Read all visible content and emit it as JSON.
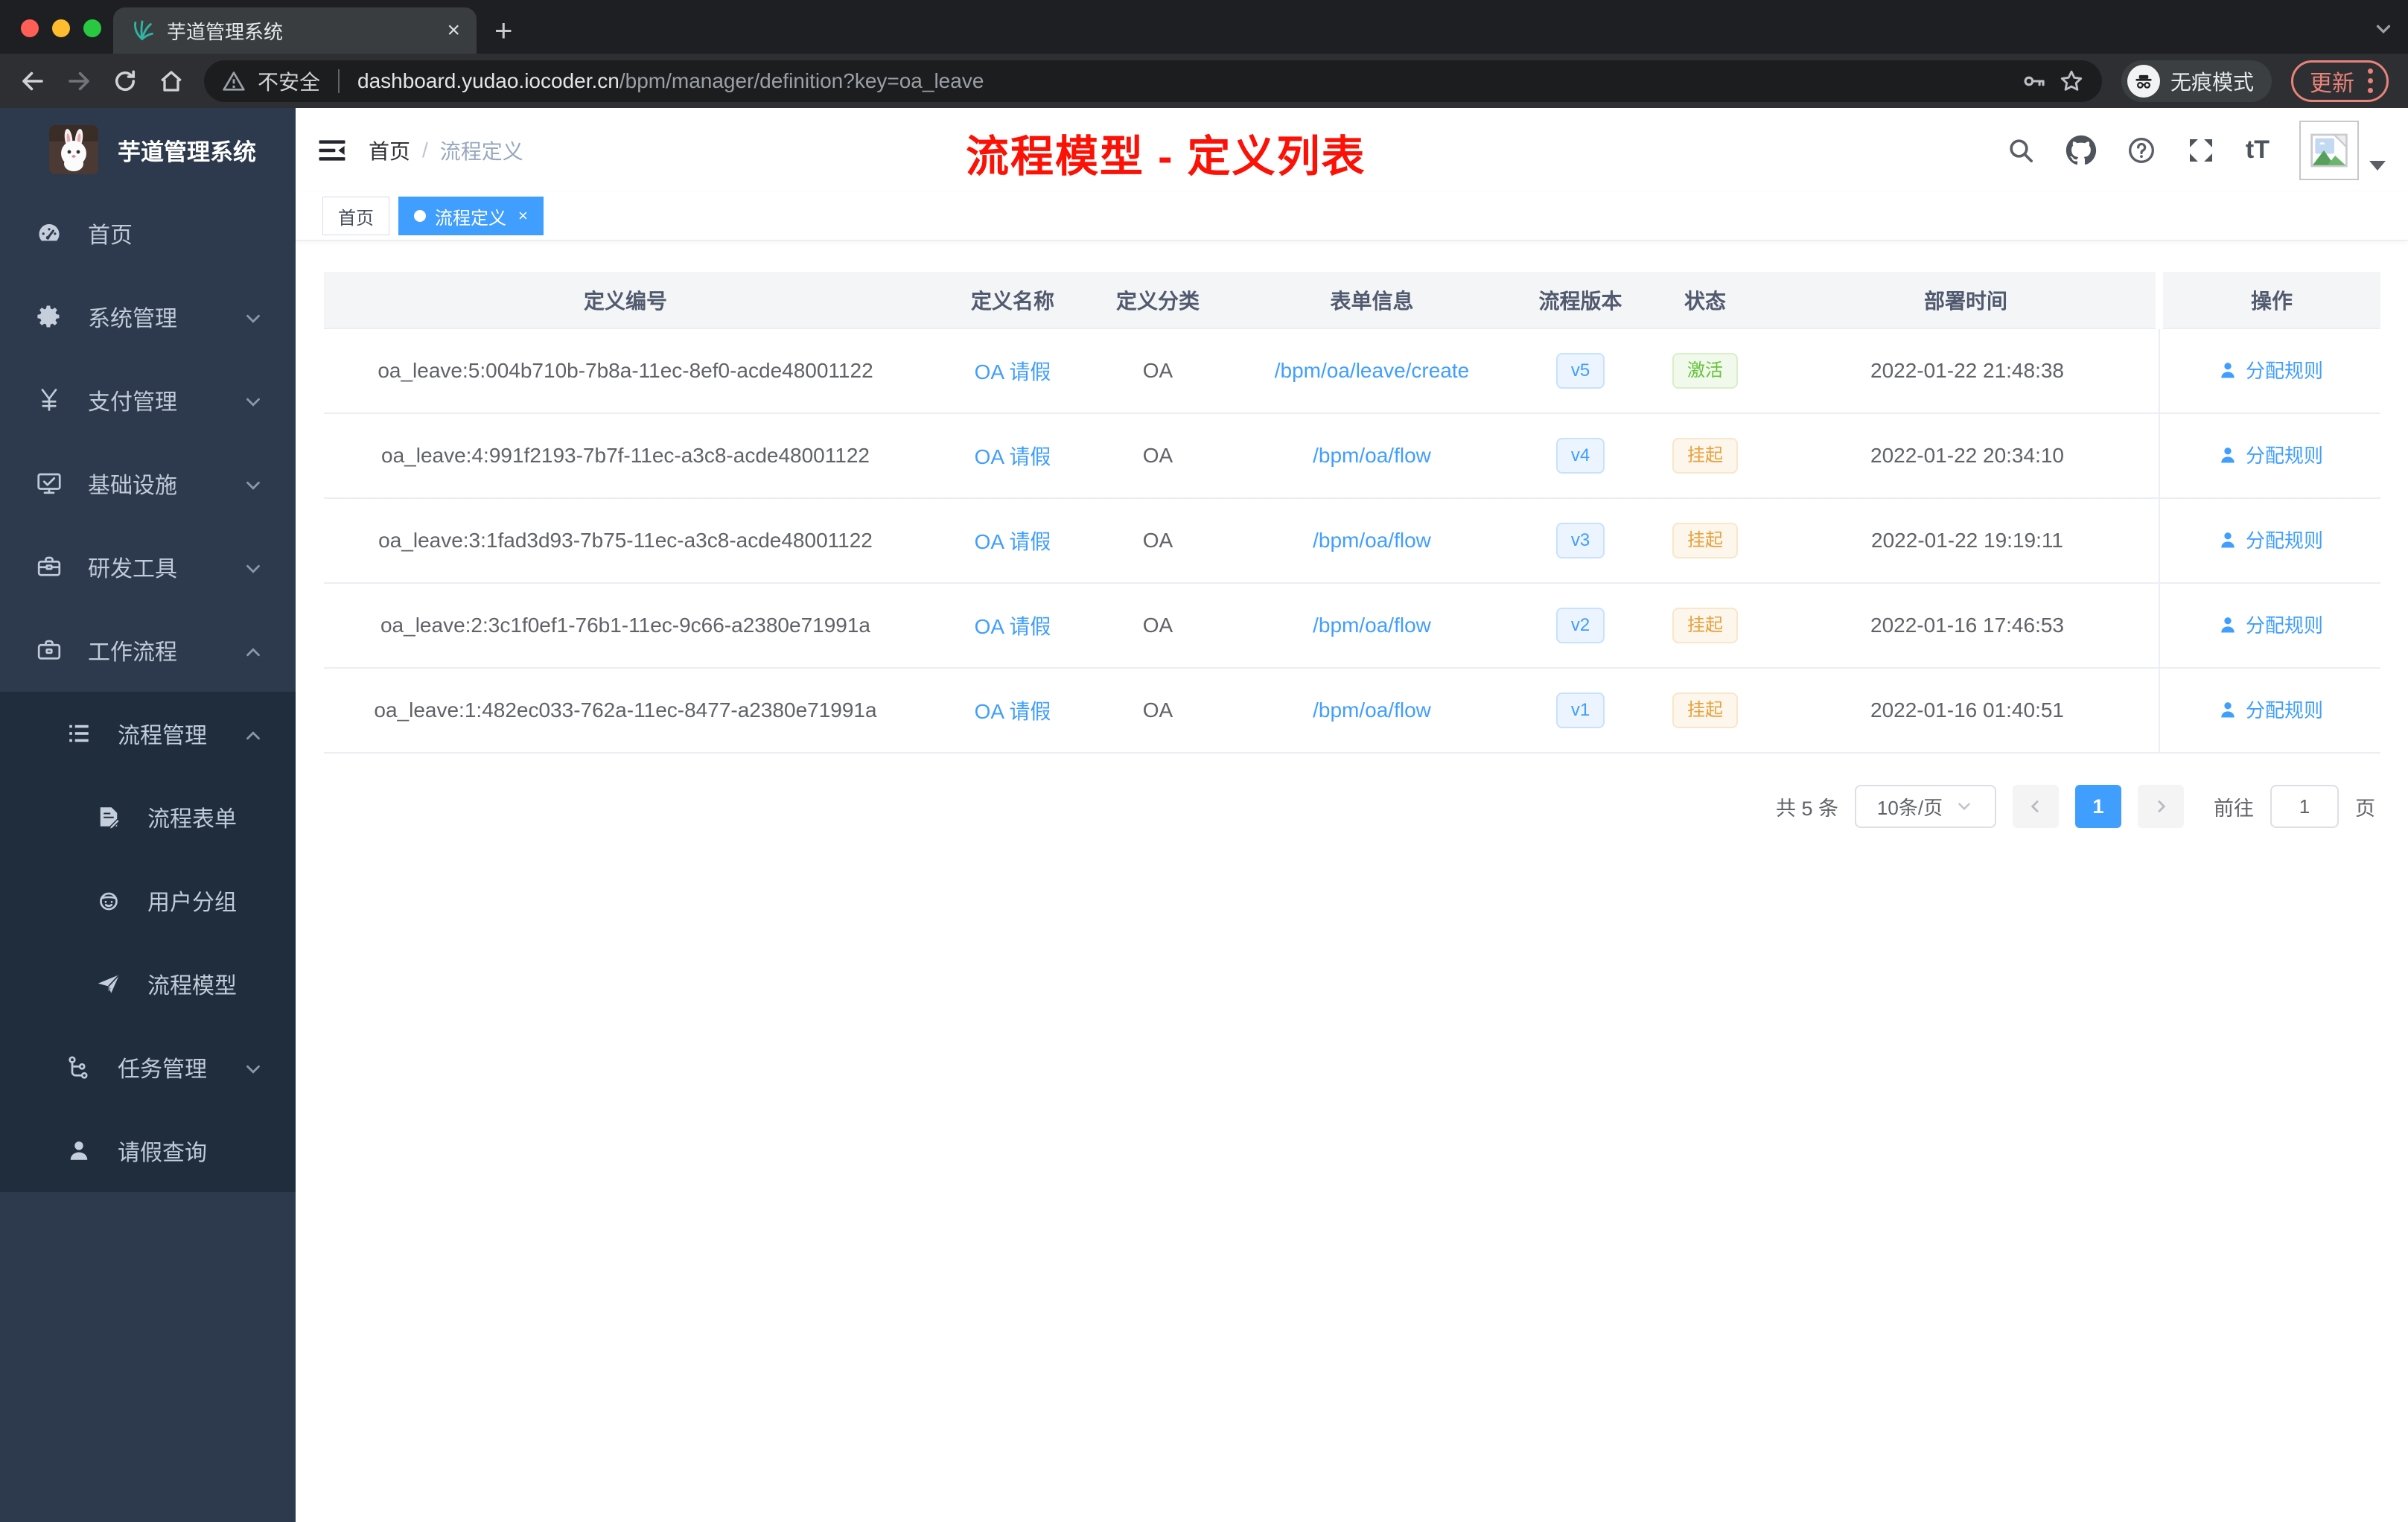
{
  "browser": {
    "tab_title": "芋道管理系统",
    "security_label": "不安全",
    "url_host": "dashboard.yudao.iocoder.cn",
    "url_path": "/bpm/manager/definition?key=oa_leave",
    "incognito_label": "无痕模式",
    "update_label": "更新"
  },
  "sidebar": {
    "app_title": "芋道管理系统",
    "items": [
      {
        "key": "home",
        "label": "首页",
        "icon": "dashboard-icon",
        "level": 1,
        "submenu": false,
        "chevron": ""
      },
      {
        "key": "system",
        "label": "系统管理",
        "icon": "gear-icon",
        "level": 1,
        "submenu": false,
        "chevron": "down"
      },
      {
        "key": "payment",
        "label": "支付管理",
        "icon": "yen-icon",
        "level": 1,
        "submenu": false,
        "chevron": "down"
      },
      {
        "key": "infrastructure",
        "label": "基础设施",
        "icon": "monitor-icon",
        "level": 1,
        "submenu": false,
        "chevron": "down"
      },
      {
        "key": "dev-tools",
        "label": "研发工具",
        "icon": "toolbox-icon",
        "level": 1,
        "submenu": false,
        "chevron": "down"
      },
      {
        "key": "workflow",
        "label": "工作流程",
        "icon": "briefcase-icon",
        "level": 1,
        "submenu": false,
        "chevron": "up"
      },
      {
        "key": "process-manage",
        "label": "流程管理",
        "icon": "list-icon",
        "level": 2,
        "submenu": true,
        "chevron": "up"
      },
      {
        "key": "process-form",
        "label": "流程表单",
        "icon": "form-icon",
        "level": 3,
        "submenu": true,
        "chevron": ""
      },
      {
        "key": "user-group",
        "label": "用户分组",
        "icon": "user-group-icon",
        "level": 3,
        "submenu": true,
        "chevron": ""
      },
      {
        "key": "process-model",
        "label": "流程模型",
        "icon": "paper-plane-icon",
        "level": 3,
        "submenu": true,
        "chevron": ""
      },
      {
        "key": "task-manage",
        "label": "任务管理",
        "icon": "tasks-icon",
        "level": 2,
        "submenu": true,
        "chevron": "down"
      },
      {
        "key": "leave-query",
        "label": "请假查询",
        "icon": "person-icon",
        "level": 2,
        "submenu": true,
        "chevron": ""
      }
    ]
  },
  "header": {
    "breadcrumb": {
      "0": "首页",
      "sep": "/",
      "1": "流程定义"
    },
    "annotation": "流程模型 - 定义列表"
  },
  "tags": [
    {
      "label": "首页",
      "active": false
    },
    {
      "label": "流程定义",
      "active": true
    }
  ],
  "table": {
    "columns": [
      "定义编号",
      "定义名称",
      "定义分类",
      "表单信息",
      "流程版本",
      "状态",
      "部署时间",
      "操作"
    ],
    "action_label": "分配规则",
    "rows": [
      {
        "id": "oa_leave:5:004b710b-7b8a-11ec-8ef0-acde48001122",
        "name": "OA 请假",
        "category": "OA",
        "form": "/bpm/oa/leave/create",
        "version": "v5",
        "status": "激活",
        "status_type": "active",
        "deployed_at": "2022-01-22 21:48:38"
      },
      {
        "id": "oa_leave:4:991f2193-7b7f-11ec-a3c8-acde48001122",
        "name": "OA 请假",
        "category": "OA",
        "form": "/bpm/oa/flow",
        "version": "v4",
        "status": "挂起",
        "status_type": "suspend",
        "deployed_at": "2022-01-22 20:34:10"
      },
      {
        "id": "oa_leave:3:1fad3d93-7b75-11ec-a3c8-acde48001122",
        "name": "OA 请假",
        "category": "OA",
        "form": "/bpm/oa/flow",
        "version": "v3",
        "status": "挂起",
        "status_type": "suspend",
        "deployed_at": "2022-01-22 19:19:11"
      },
      {
        "id": "oa_leave:2:3c1f0ef1-76b1-11ec-9c66-a2380e71991a",
        "name": "OA 请假",
        "category": "OA",
        "form": "/bpm/oa/flow",
        "version": "v2",
        "status": "挂起",
        "status_type": "suspend",
        "deployed_at": "2022-01-16 17:46:53"
      },
      {
        "id": "oa_leave:1:482ec033-762a-11ec-8477-a2380e71991a",
        "name": "OA 请假",
        "category": "OA",
        "form": "/bpm/oa/flow",
        "version": "v1",
        "status": "挂起",
        "status_type": "suspend",
        "deployed_at": "2022-01-16 01:40:51"
      }
    ]
  },
  "pagination": {
    "total": "共 5 条",
    "page_size": "10条/页",
    "current_page": "1",
    "goto_label": "前往",
    "goto_value": "1",
    "goto_unit": "页"
  },
  "colors": {
    "accent_blue": "#409eff",
    "status_green": "#67c23a",
    "status_orange": "#e6a23c",
    "annotation_red": "#fb1105",
    "sidebar_bg": "#2d3a4d",
    "sidebar_sub_bg": "#1f2d3d"
  }
}
